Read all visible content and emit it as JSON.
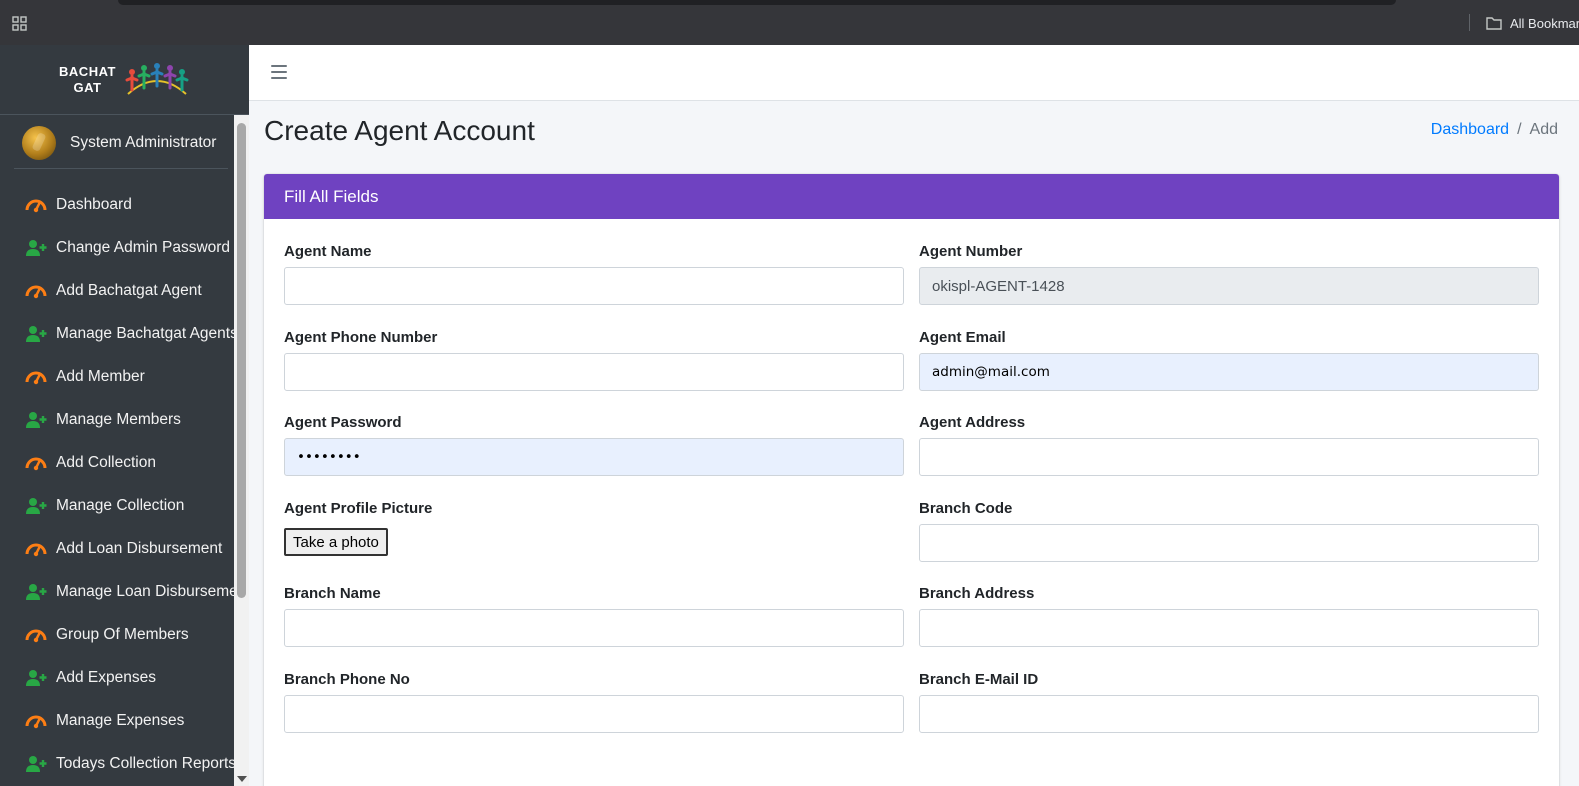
{
  "browser": {
    "bookmarks_label": "All Bookmarks"
  },
  "sidebar": {
    "brand_line1": "BACHAT",
    "brand_line2": "GAT",
    "user_name": "System Administrator",
    "items": [
      {
        "label": "Dashboard",
        "icon": "tachometer-icon"
      },
      {
        "label": "Change Admin Password",
        "icon": "user-plus-icon"
      },
      {
        "label": "Add Bachatgat Agent",
        "icon": "tachometer-icon"
      },
      {
        "label": "Manage Bachatgat Agents",
        "icon": "user-plus-icon"
      },
      {
        "label": "Add Member",
        "icon": "tachometer-icon"
      },
      {
        "label": "Manage Members",
        "icon": "user-plus-icon"
      },
      {
        "label": "Add Collection",
        "icon": "tachometer-icon"
      },
      {
        "label": "Manage Collection",
        "icon": "user-plus-icon"
      },
      {
        "label": "Add Loan Disbursement",
        "icon": "tachometer-icon"
      },
      {
        "label": "Manage Loan Disburseme",
        "icon": "user-plus-icon"
      },
      {
        "label": "Group Of Members",
        "icon": "tachometer-icon"
      },
      {
        "label": "Add Expenses",
        "icon": "user-plus-icon"
      },
      {
        "label": "Manage Expenses",
        "icon": "tachometer-icon"
      },
      {
        "label": "Todays Collection Reports",
        "icon": "user-plus-icon"
      }
    ]
  },
  "header": {
    "title": "Create Agent Account",
    "breadcrumb_home": "Dashboard",
    "breadcrumb_sep": "/",
    "breadcrumb_current": "Add"
  },
  "form": {
    "card_title": "Fill All Fields",
    "agent_name": {
      "label": "Agent Name",
      "value": ""
    },
    "agent_number": {
      "label": "Agent Number",
      "value": "okispl-AGENT-1428"
    },
    "agent_phone": {
      "label": "Agent Phone Number",
      "value": ""
    },
    "agent_email": {
      "label": "Agent Email",
      "value": "admin@mail.com"
    },
    "agent_password": {
      "label": "Agent Password",
      "value": "••••••••"
    },
    "agent_address": {
      "label": "Agent Address",
      "value": ""
    },
    "agent_picture": {
      "label": "Agent Profile Picture",
      "button": "Take a photo"
    },
    "branch_code": {
      "label": "Branch Code",
      "value": ""
    },
    "branch_name": {
      "label": "Branch Name",
      "value": ""
    },
    "branch_address": {
      "label": "Branch Address",
      "value": ""
    },
    "branch_phone": {
      "label": "Branch Phone No",
      "value": ""
    },
    "branch_email": {
      "label": "Branch E-Mail ID",
      "value": ""
    }
  },
  "colors": {
    "sidebar_bg": "#343a40",
    "card_header": "#6f42c1",
    "icon_orange": "#fd7e14",
    "icon_green": "#28a745",
    "link": "#007bff"
  }
}
